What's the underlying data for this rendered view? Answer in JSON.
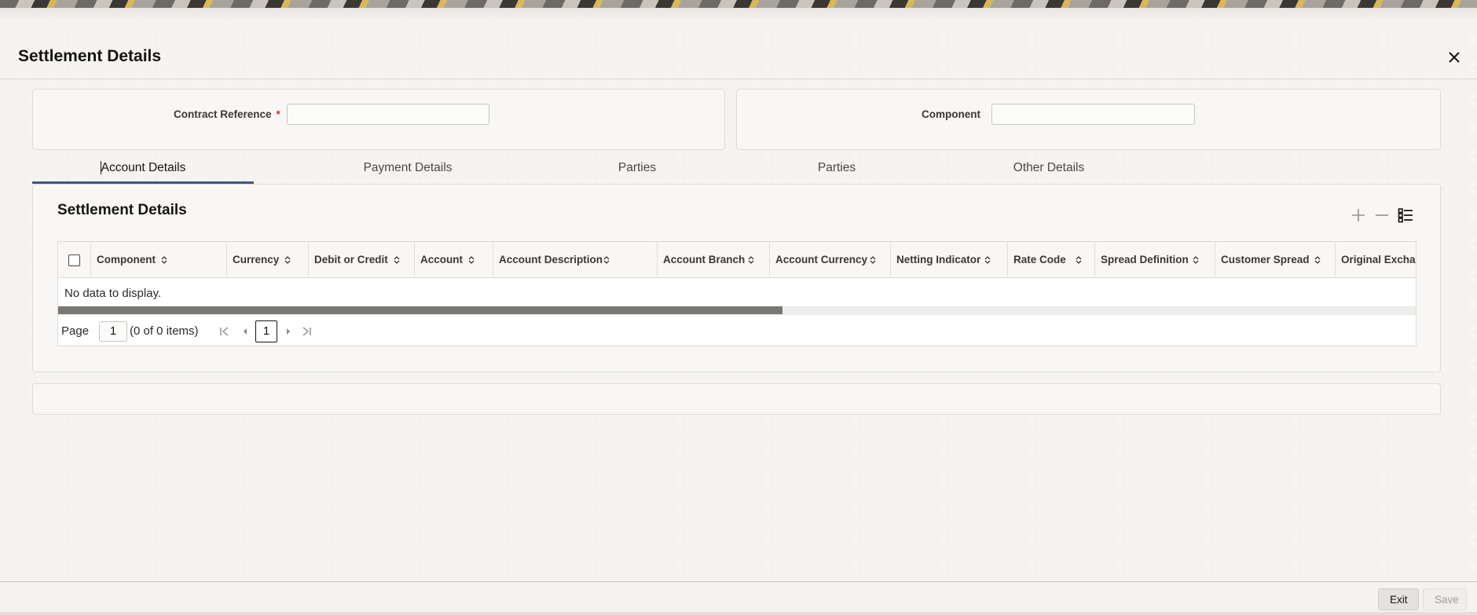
{
  "header": {
    "title": "Settlement Details"
  },
  "form": {
    "contract_reference_label": "Contract Reference",
    "required_marker": "*",
    "contract_reference_value": "",
    "component_label": "Component",
    "component_value": ""
  },
  "tabs": [
    {
      "label": "Account Details",
      "active": true
    },
    {
      "label": "Payment Details",
      "active": false
    },
    {
      "label": "Parties",
      "active": false
    },
    {
      "label": "Parties",
      "active": false
    },
    {
      "label": "Other Details",
      "active": false
    }
  ],
  "section": {
    "title": "Settlement Details"
  },
  "toolbar": {
    "icons": [
      "add-icon",
      "remove-icon",
      "single-record-view-icon"
    ]
  },
  "grid": {
    "columns": [
      "Component",
      "Currency",
      "Debit or Credit",
      "Account",
      "Account Description",
      "Account Branch",
      "Account Currency",
      "Netting Indicator",
      "Rate Code",
      "Spread Definition",
      "Customer Spread",
      "Original Exchange"
    ],
    "empty_message": "No data to display."
  },
  "pager": {
    "page_label": "Page",
    "page_value": "1",
    "count_text": "(0 of 0 items)",
    "current_page": "1"
  },
  "footer": {
    "exit_label": "Exit",
    "save_label": "Save"
  }
}
